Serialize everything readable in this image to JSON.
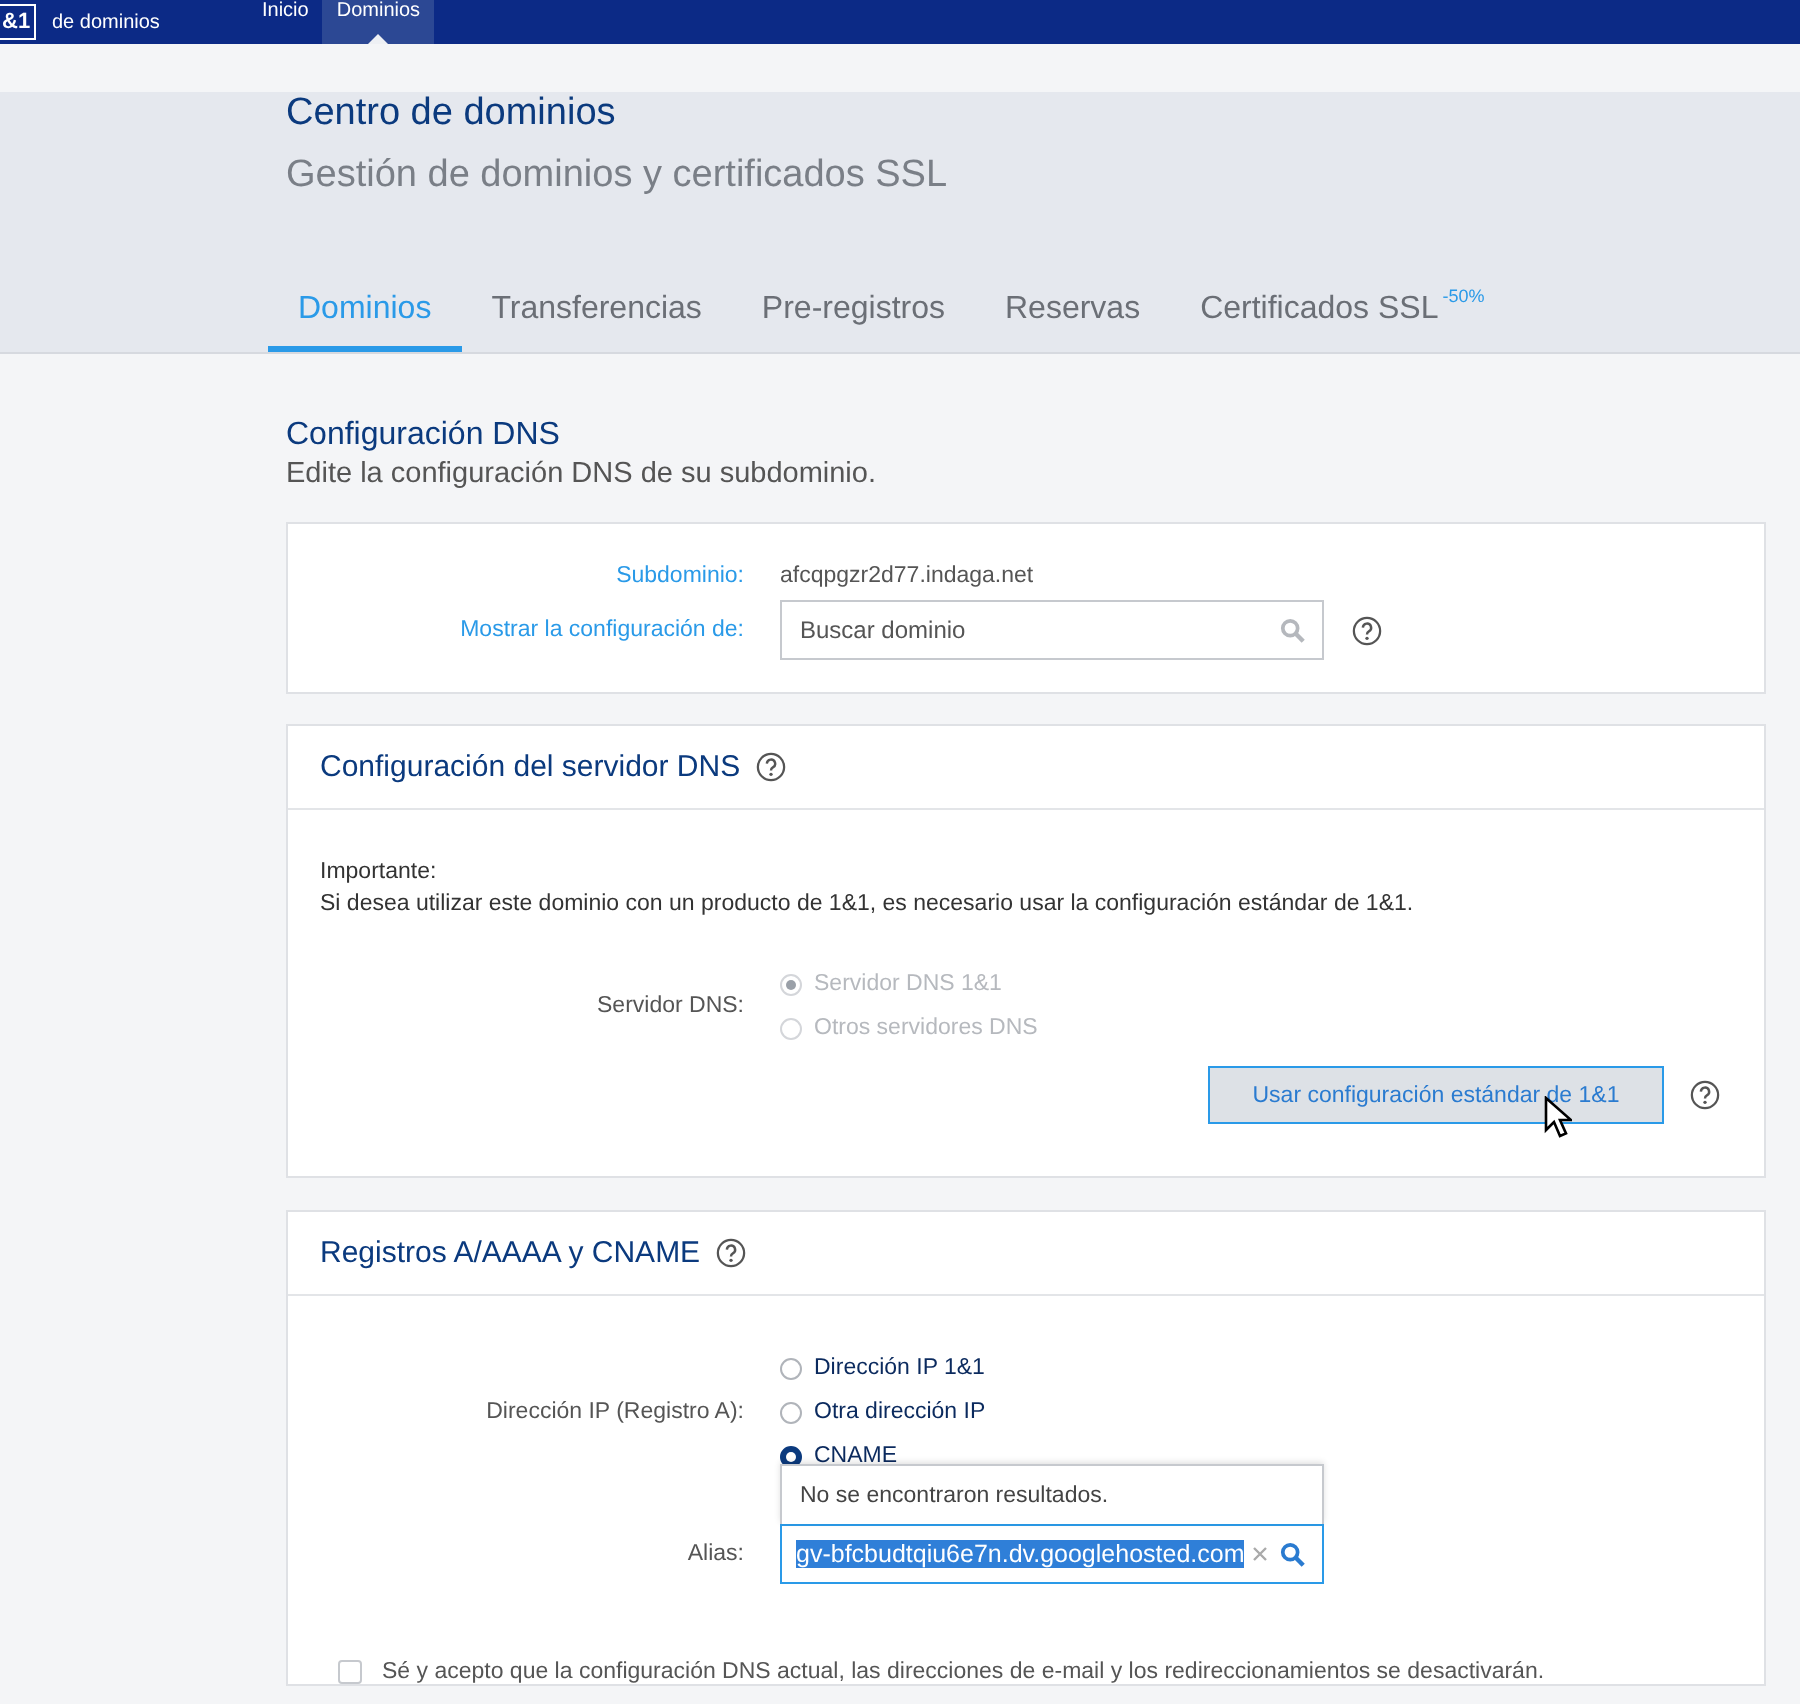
{
  "topbar": {
    "logo": "&1",
    "product": "de dominios",
    "nav": [
      {
        "label": "Inicio",
        "selected": false
      },
      {
        "label": "Dominios",
        "selected": true
      }
    ]
  },
  "header": {
    "title": "Centro de dominios",
    "subtitle": "Gestión de dominios y certificados SSL"
  },
  "tabs": [
    {
      "label": "Dominios",
      "selected": true
    },
    {
      "label": "Transferencias",
      "selected": false
    },
    {
      "label": "Pre-registros",
      "selected": false
    },
    {
      "label": "Reservas",
      "selected": false
    },
    {
      "label": "Certificados SSL",
      "selected": false,
      "badge": "-50%"
    }
  ],
  "section": {
    "title": "Configuración DNS",
    "subtitle": "Edite la configuración DNS de su subdominio."
  },
  "domain_card": {
    "rows": [
      {
        "kind": "text",
        "label": "Subdominio:",
        "value": "afcqpgzr2d77.indaga.net"
      },
      {
        "kind": "search",
        "label": "Mostrar la configuración de:",
        "placeholder": "Buscar dominio"
      }
    ]
  },
  "dns_server_card": {
    "title": "Configuración del servidor DNS",
    "notice_title": "Importante:",
    "notice": "Si desea utilizar este dominio con un producto de 1&1, es necesario usar la configuración estándar de 1&1.",
    "field_label": "Servidor DNS:",
    "options": [
      {
        "label": "Servidor DNS 1&1",
        "selected": true,
        "disabled": true
      },
      {
        "label": "Otros servidores DNS",
        "selected": false,
        "disabled": true
      }
    ],
    "button": "Usar configuración estándar de 1&1"
  },
  "records_card": {
    "title": "Registros A/AAAA y CNAME",
    "field_label": "Dirección IP (Registro A):",
    "options": [
      {
        "label": "Dirección IP 1&1",
        "selected": false,
        "disabled": false
      },
      {
        "label": "Otra dirección IP",
        "selected": false,
        "disabled": false
      },
      {
        "label": "CNAME",
        "selected": true,
        "disabled": false
      }
    ],
    "alias_label": "Alias:",
    "alias_value": "gv-bfcbudtqiu6e7n.dv.googlehosted.com",
    "dropdown_message": "No se encontraron resultados."
  },
  "consent": {
    "label": "Sé y acepto que la configuración DNS actual, las direcciones de e-mail y los redireccionamientos se desactivarán.",
    "checked": false
  }
}
